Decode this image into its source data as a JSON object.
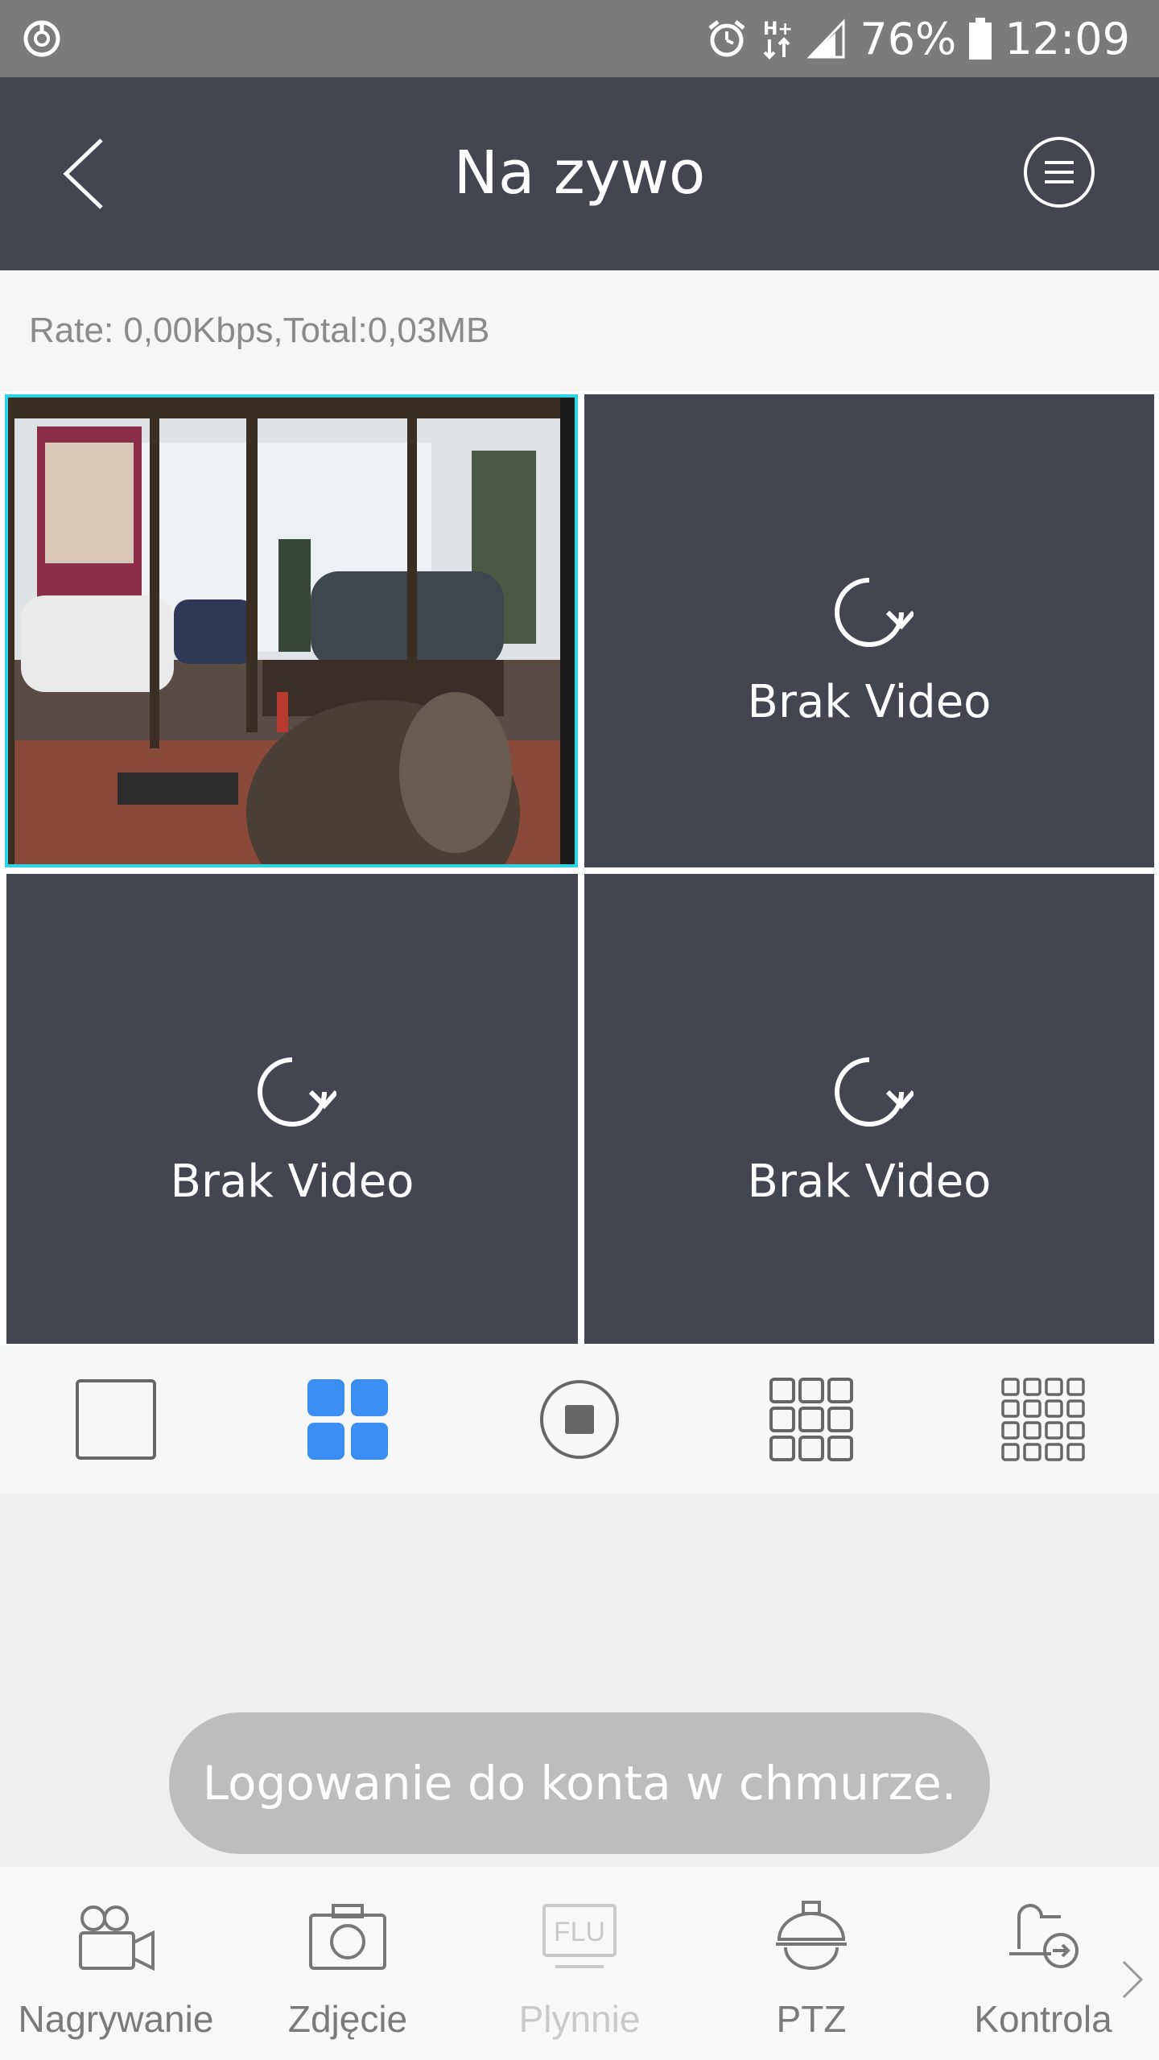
{
  "status_bar": {
    "battery": "76%",
    "time": "12:09",
    "icons": [
      "sync-icon",
      "alarm-icon",
      "network-hplus-icon",
      "signal-icon",
      "battery-icon"
    ]
  },
  "header": {
    "title": "Na zywo",
    "icons": [
      "back-icon",
      "menu-icon"
    ]
  },
  "rate": "Rate: 0,00Kbps,Total:0,03MB",
  "video_cells": [
    {
      "type": "live",
      "content": "camera view"
    },
    {
      "type": "empty",
      "label": "Brak Video"
    },
    {
      "type": "empty",
      "label": "Brak Video"
    },
    {
      "type": "empty",
      "label": "Brak Video"
    }
  ],
  "layout_options": [
    {
      "name": "single-view-icon",
      "selected": false
    },
    {
      "name": "four-view-icon",
      "selected": true
    },
    {
      "name": "stop-icon",
      "selected": false
    },
    {
      "name": "nine-view-icon",
      "selected": false
    },
    {
      "name": "sixteen-view-icon",
      "selected": false
    }
  ],
  "toast": "Logowanie do konta w chmurze.",
  "bottom_nav": [
    {
      "label": "Nagrywanie",
      "icon": "video-camera-icon",
      "enabled": true
    },
    {
      "label": "Zdjęcie",
      "icon": "camera-icon",
      "enabled": true
    },
    {
      "label": "Plynnie",
      "icon": "flu-icon",
      "icon_text": "FLU",
      "enabled": false
    },
    {
      "label": "PTZ",
      "icon": "dome-camera-icon",
      "enabled": true
    },
    {
      "label": "Kontrola",
      "icon": "control-icon",
      "enabled": true
    }
  ],
  "colors": {
    "header": "#434650",
    "selected_outline": "#2ed3e6",
    "accent": "#3b8ff3",
    "status_bar": "#7b7b7b"
  }
}
